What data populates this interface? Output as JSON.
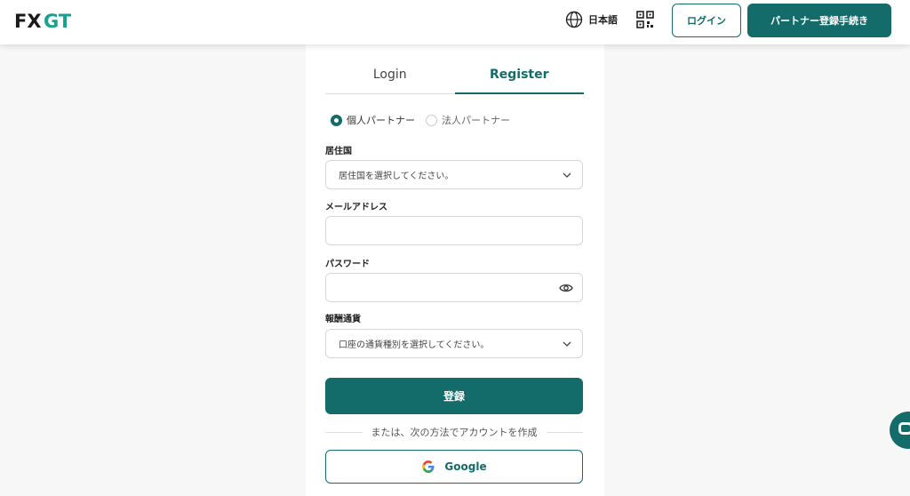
{
  "header": {
    "logo": "FXGT",
    "language": "日本語",
    "login_label": "ログイン",
    "partner_register_label": "パートナー登録手続き"
  },
  "tabs": [
    {
      "label": "Login",
      "active": false
    },
    {
      "label": "Register",
      "active": true
    }
  ],
  "partner_type": {
    "options": [
      {
        "label": "個人パートナー",
        "selected": true
      },
      {
        "label": "法人パートナー",
        "selected": false
      }
    ]
  },
  "form": {
    "country": {
      "label": "居住国",
      "placeholder": "居住国を選択してください。"
    },
    "email": {
      "label": "メールアドレス",
      "value": ""
    },
    "password": {
      "label": "パスワード",
      "value": ""
    },
    "currency": {
      "label": "報酬通貨",
      "placeholder": "口座の通貨種別を選択してください。"
    },
    "submit_label": "登録",
    "divider_text": "または、次の方法でアカウントを作成",
    "google_label": "Google"
  },
  "colors": {
    "accent": "#136b6a"
  },
  "icons": {
    "language": "globe-icon",
    "qr": "qr-code-icon",
    "select": "chevron-down-icon",
    "password_toggle": "eye-icon",
    "google": "google-icon",
    "chat": "chat-icon"
  }
}
